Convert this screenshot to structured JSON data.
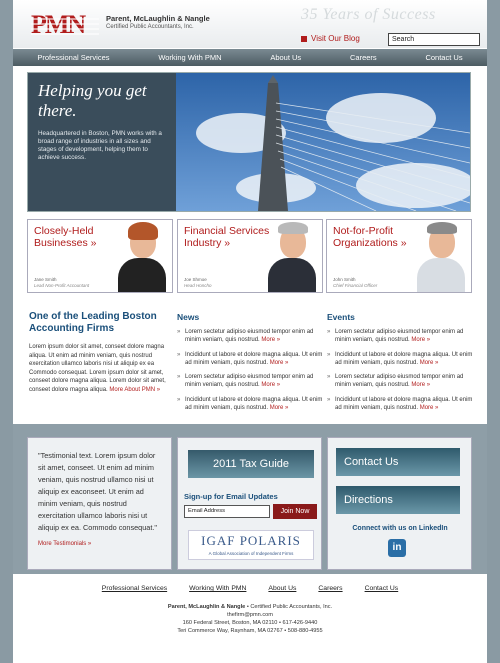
{
  "header": {
    "logo": "PMN",
    "firm_name": "Parent, McLaughlin & Nangle",
    "firm_sub": "Certified Public Accountants, Inc.",
    "tagline": "35 Years of Success",
    "blog_link": "Visit Our Blog",
    "search_placeholder": "Search"
  },
  "nav": {
    "items": [
      "Professional Services",
      "Working With PMN",
      "About Us",
      "Careers",
      "Contact Us"
    ]
  },
  "hero": {
    "title_line1": "Helping you get",
    "title_line2": "there.",
    "text": "Headquartered in Boston, PMN works with a broad range of industries in all sizes and stages of development, helping them to achieve success."
  },
  "boxes": [
    {
      "title_line1": "Closely-Held",
      "title_line2": "Businesses »",
      "name": "Jane Smith",
      "role": "Lead Non-Profit Accountant"
    },
    {
      "title_line1": "Financial Services",
      "title_line2": "Industry »",
      "name": "Joe Shmoe",
      "role": "Head Honcho"
    },
    {
      "title_line1": "Not-for-Profit",
      "title_line2": "Organizations »",
      "name": "John Smith",
      "role": "Chief Financial Officer"
    }
  ],
  "intro": {
    "title_line1": "One of the Leading Boston",
    "title_line2": "Accounting Firms",
    "text": "Lorem ipsum dolor sit amet, conseet dolore magna aliqua. Ut enim ad minim veniam, quis nostrud exercitation ullamco laboris nisi ut aliquip ex ea Commodo consequat. Lorem ipsum dolor sit amet, conseet dolore magna aliqua. Lorem dolor sit amet, conseet dolore magna aliqua.",
    "more": "More About PMN »"
  },
  "news": {
    "title": "News",
    "items": [
      {
        "text": "Lorem sectetur adipiso eiusmod tempor enim ad minim veniam, quis nostrud.",
        "more": "More »"
      },
      {
        "text": "Incididunt ut labore et dolore magna aliqua. Ut enim ad minim veniam, quis nostrud.",
        "more": "More »"
      },
      {
        "text": "Lorem sectetur adipiso eiusmod tempor enim ad minim veniam, quis nostrud.",
        "more": "More »"
      },
      {
        "text": "Incididunt ut labore et dolore magna aliqua. Ut enim ad minim veniam, quis nostrud.",
        "more": "More »"
      }
    ]
  },
  "events": {
    "title": "Events",
    "items": [
      {
        "text": "Lorem sectetur adipiso eiusmod tempor enim ad minim veniam, quis nostrud.",
        "more": "More »"
      },
      {
        "text": "Incididunt ut labore et dolore magna aliqua. Ut enim ad minim veniam, quis nostrud.",
        "more": "More »"
      },
      {
        "text": "Lorem sectetur adipiso eiusmod tempor enim ad minim veniam, quis nostrud.",
        "more": "More »"
      },
      {
        "text": "Incididunt ut labore et dolore magna aliqua. Ut enim ad minim veniam, quis nostrud.",
        "more": "More »"
      }
    ]
  },
  "testimonial": {
    "text": "\"Testimonial text. Lorem ipsum dolor sit amet, conseet. Ut enim ad minim veniam, quis nostrud ullamco nisi ut aliquip ex eaconseet. Ut enim ad minim veniam, quis nostrud exercitation ullamco laboris nisi ut aliquip ex ea. Commodo consequat.\"",
    "more": "More Testimonials »"
  },
  "middle": {
    "tax_guide": "2011 Tax Guide",
    "signup": "Sign-up for Email Updates",
    "email_placeholder": "Email Address",
    "join": "Join Now",
    "igaf_title": "IGAF POLARIS",
    "igaf_sub": "A Global Association of Independent Firms"
  },
  "right": {
    "contact": "Contact Us",
    "directions": "Directions",
    "linkedin": "Connect with us on LinkedIn",
    "li_icon": "in"
  },
  "footer": {
    "nav": [
      "Professional Services",
      "Working With PMN",
      "About Us",
      "Careers",
      "Contact Us"
    ],
    "line1_bold": "Parent, McLaughlin & Nangle",
    "line1_rest": " • Certified Public Accountants, Inc.",
    "email": "thefirm@pmn.com",
    "address1": "160 Federal Street, Boston, MA 02110  •  617-426-9440",
    "address2": "Teri Commerce Way, Raynham, MA 02767  •  508-880-4955"
  },
  "colors": {
    "brand_red": "#b01c1c",
    "nav_gray": "#5a6a72",
    "heading_blue": "#1a4f7a"
  }
}
